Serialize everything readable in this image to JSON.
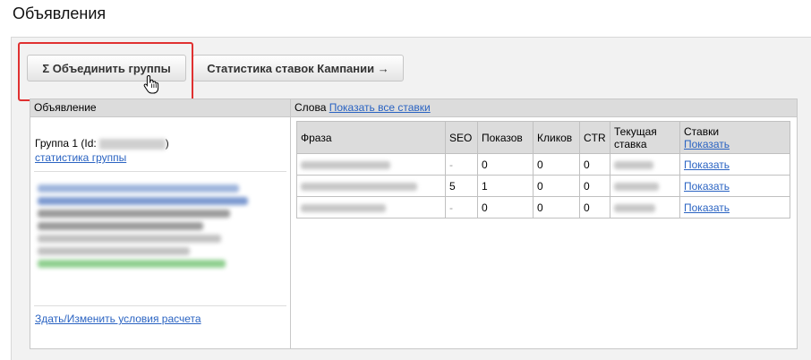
{
  "page": {
    "title": "Объявления"
  },
  "toolbar": {
    "merge_label": "Σ Объединить группы",
    "stats_label": "Статистика ставок Кампании →"
  },
  "left": {
    "header": "Объявление",
    "group_label": "Группа 1 (Id:",
    "group_label_close": ")",
    "group_stats_link": "статистика группы",
    "edit_link": "Здать/Изменить условия расчета"
  },
  "right": {
    "words_label": "Слова",
    "show_all_link": "Показать все ставки",
    "table": {
      "headers": [
        "Фраза",
        "SEO",
        "Показов",
        "Кликов",
        "CTR",
        "Текущая ставка",
        "Ставки"
      ],
      "stavki_header_link": "Показать",
      "rows": [
        {
          "seo": "-",
          "shows": "0",
          "clicks": "0",
          "ctr": "0",
          "action": "Показать"
        },
        {
          "seo": "5",
          "shows": "1",
          "clicks": "0",
          "ctr": "0",
          "action": "Показать"
        },
        {
          "seo": "-",
          "shows": "0",
          "clicks": "0",
          "ctr": "0",
          "action": "Показать"
        }
      ]
    }
  },
  "colors": {
    "link": "#2a63c2",
    "highlight": "#e03131",
    "header_bg": "#dcdcdc"
  }
}
